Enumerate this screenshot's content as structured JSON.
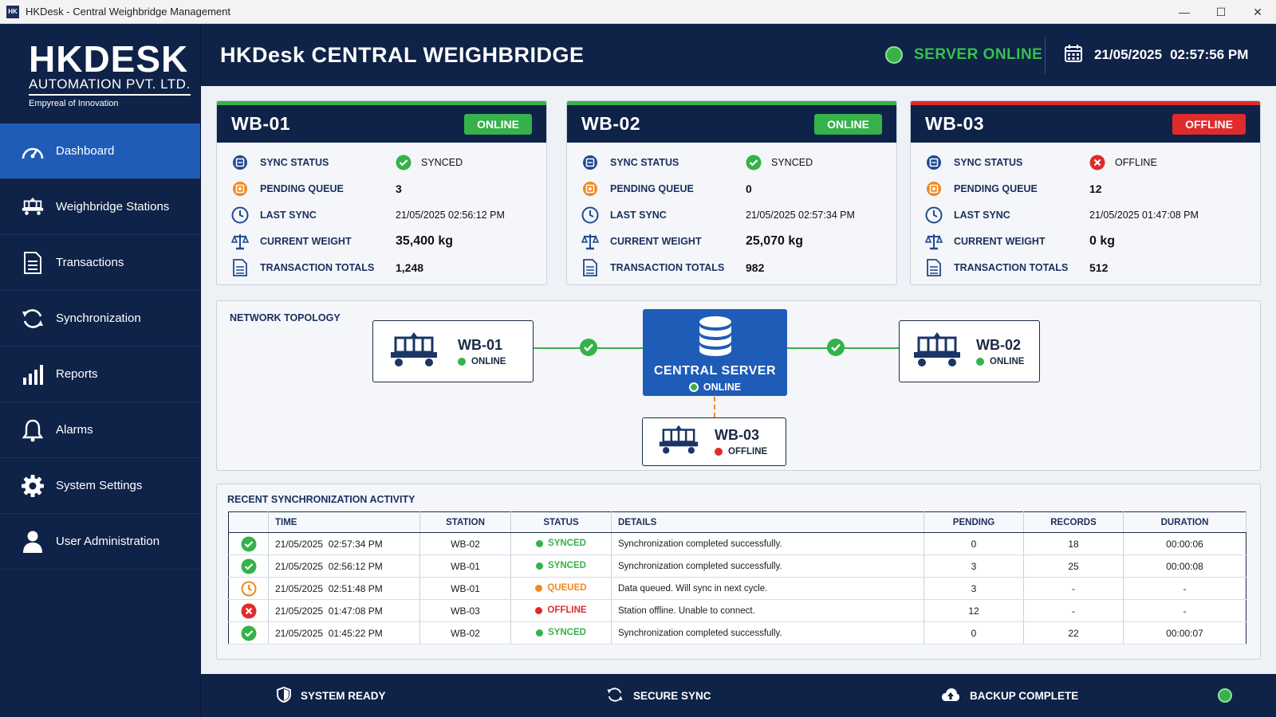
{
  "window": {
    "app_icon": "HK",
    "title": "HKDesk - Central Weighbridge Management",
    "controls": [
      "—",
      "☐",
      "✕"
    ]
  },
  "logo": {
    "line1": "HKDESK",
    "line2": "AUTOMATION PVT. LTD.",
    "tagline": "Empyreal of Innovation"
  },
  "sidebar": {
    "items": [
      {
        "label": "Dashboard",
        "icon": "gauge-icon",
        "active": true
      },
      {
        "label": "Weighbridge Stations",
        "icon": "weighbridge-icon"
      },
      {
        "label": "Transactions",
        "icon": "document-icon"
      },
      {
        "label": "Synchronization",
        "icon": "sync-icon"
      },
      {
        "label": "Reports",
        "icon": "bar-chart-icon"
      },
      {
        "label": "Alarms",
        "icon": "bell-icon"
      },
      {
        "label": "System Settings",
        "icon": "gear-icon"
      },
      {
        "label": "User Administration",
        "icon": "user-icon"
      }
    ]
  },
  "header": {
    "title": "HKDesk CENTRAL WEIGHBRIDGE",
    "server_status": "SERVER ONLINE",
    "date": "21/05/2025",
    "time": "02:57:56 PM"
  },
  "labels": {
    "sync_status": "SYNC STATUS",
    "pending_queue": "PENDING QUEUE",
    "last_sync": "LAST SYNC",
    "current_weight": "CURRENT WEIGHT",
    "transaction_totals": "TRANSACTION TOTALS"
  },
  "stations": [
    {
      "name": "WB-01",
      "badge": "ONLINE",
      "sync": "SYNCED",
      "pending": "3",
      "last_sync": "21/05/2025 02:56:12 PM",
      "weight": "35,400 kg",
      "totals": "1,248",
      "color": "#35b24a"
    },
    {
      "name": "WB-02",
      "badge": "ONLINE",
      "sync": "SYNCED",
      "pending": "0",
      "last_sync": "21/05/2025 02:57:34 PM",
      "weight": "25,070 kg",
      "totals": "982",
      "color": "#35b24a"
    },
    {
      "name": "WB-03",
      "badge": "OFFLINE",
      "sync": "OFFLINE",
      "pending": "12",
      "last_sync": "21/05/2025 01:47:08 PM",
      "weight": "0 kg",
      "totals": "512",
      "color": "#e02b2b"
    }
  ],
  "topology": {
    "title": "NETWORK TOPOLOGY",
    "server_name": "CENTRAL SERVER",
    "server_status": "ONLINE",
    "nodes": [
      {
        "name": "WB-01",
        "status": "ONLINE"
      },
      {
        "name": "WB-02",
        "status": "ONLINE"
      },
      {
        "name": "WB-03",
        "status": "OFFLINE"
      }
    ]
  },
  "activity": {
    "title": "RECENT SYNCHRONIZATION ACTIVITY",
    "columns": [
      "TIME",
      "STATION",
      "STATUS",
      "DETAILS",
      "PENDING",
      "RECORDS",
      "DURATION"
    ],
    "rows": [
      {
        "icon": "check-icon",
        "time": "21/05/2025  02:57:34 PM",
        "station": "WB-02",
        "status": "SYNCED",
        "details": "Synchronization completed successfully.",
        "pending": "0",
        "records": "18",
        "duration": "00:00:06"
      },
      {
        "icon": "check-icon",
        "time": "21/05/2025  02:56:12 PM",
        "station": "WB-01",
        "status": "SYNCED",
        "details": "Synchronization completed successfully.",
        "pending": "3",
        "records": "25",
        "duration": "00:00:08"
      },
      {
        "icon": "clock-icon",
        "time": "21/05/2025  02:51:48 PM",
        "station": "WB-01",
        "status": "QUEUED",
        "details": "Data queued. Will sync in next cycle.",
        "pending": "3",
        "records": "-",
        "duration": "-"
      },
      {
        "icon": "error-icon",
        "time": "21/05/2025  01:47:08 PM",
        "station": "WB-03",
        "status": "OFFLINE",
        "details": "Station offline. Unable to connect.",
        "pending": "12",
        "records": "-",
        "duration": "-"
      },
      {
        "icon": "check-icon",
        "time": "21/05/2025  01:45:22 PM",
        "station": "WB-02",
        "status": "SYNCED",
        "details": "Synchronization completed successfully.",
        "pending": "0",
        "records": "22",
        "duration": "00:00:07"
      }
    ]
  },
  "footer": {
    "system": "SYSTEM READY",
    "sync": "SECURE SYNC",
    "backup": "BACKUP COMPLETE"
  },
  "colors": {
    "navy": "#0f2248",
    "accent_blue": "#1f5cb8",
    "green": "#35b24a",
    "red": "#e02b2b",
    "orange": "#f08a1c"
  }
}
